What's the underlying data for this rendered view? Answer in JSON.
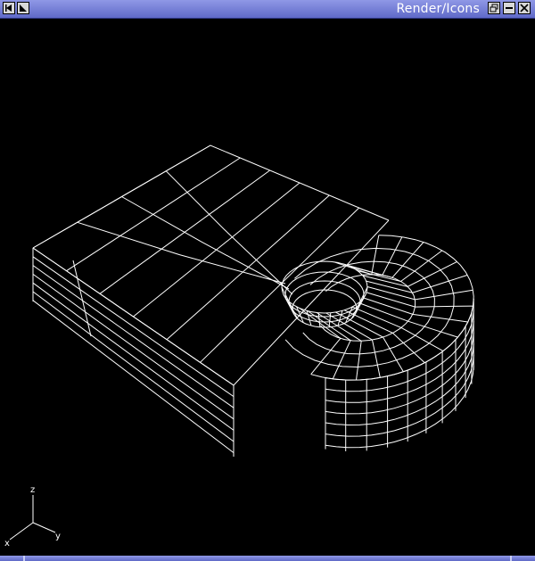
{
  "window": {
    "title": "Render/Icons"
  },
  "titlebar_buttons": {
    "left": [
      "window-menu-icon",
      "nav-arrow-icon"
    ],
    "right": [
      "restore-icon",
      "minimize-icon",
      "close-icon"
    ]
  },
  "axes_triad": {
    "z_label": "z",
    "x_label": "x",
    "y_label": "y"
  },
  "colors": {
    "titlebar": "#7b84d8",
    "wireframe": "#ffffff",
    "background": "#000000"
  }
}
